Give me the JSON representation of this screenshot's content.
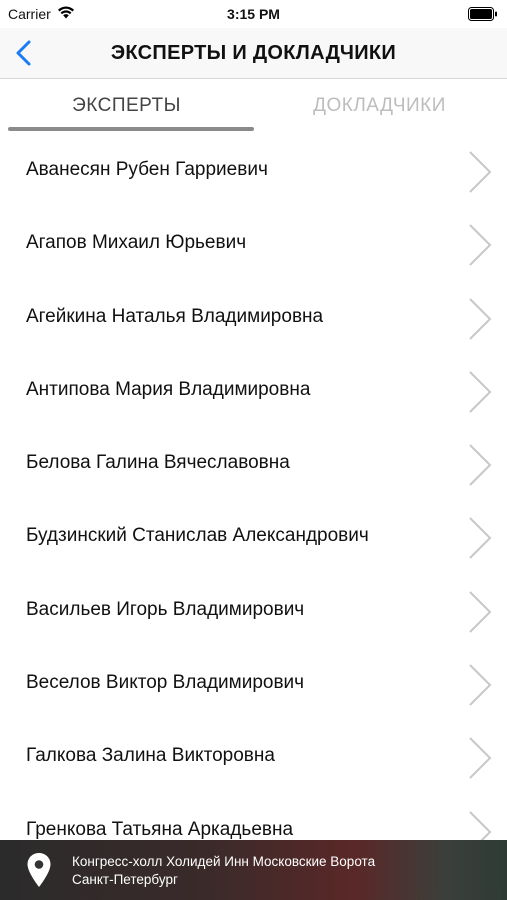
{
  "status_bar": {
    "carrier": "Carrier",
    "time": "3:15 PM",
    "wifi_icon": "wifi-icon",
    "battery_icon": "battery-icon"
  },
  "nav": {
    "title": "ЭКСПЕРТЫ И ДОКЛАДЧИКИ",
    "back_icon": "chevron-left-icon"
  },
  "tabs": [
    {
      "label": "ЭКСПЕРТЫ",
      "selected": true
    },
    {
      "label": "ДОКЛАДЧИКИ",
      "selected": false
    }
  ],
  "list": {
    "items": [
      "Аванесян Рубен Гарриевич",
      "Агапов Михаил Юрьевич",
      "Агейкина Наталья Владимировна",
      "Антипова Мария Владимировна",
      "Белова Галина Вячеславовна",
      "Будзинский Станислав Александрович",
      "Васильев Игорь Владимирович",
      "Веселов Виктор Владимирович",
      "Галкова Залина Викторовна",
      "Гренкова Татьяна Аркадьевна"
    ],
    "chevron_icon": "chevron-right-icon"
  },
  "address": {
    "line1": "Конгресс-холл Холидей Инн Московские Ворота",
    "line2": "Санкт-Петербург",
    "icon": "map-pin-icon"
  },
  "colors": {
    "tab_active": "#444444",
    "tab_inactive": "#bdbdbd",
    "back_accent": "#1a7cf5",
    "chevron": "#c7c7cc"
  }
}
